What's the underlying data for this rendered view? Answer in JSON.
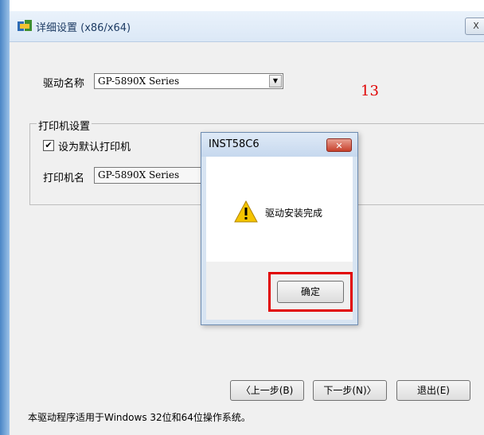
{
  "window": {
    "title": "详细设置 (x86/x64)",
    "close_symbol": "X"
  },
  "driver": {
    "label": "驱动名称",
    "value": "GP-5890X Series"
  },
  "annotation": "13",
  "printer_group": {
    "title": "打印机设置",
    "default_checkbox_label": "设为默认打印机",
    "default_checked": "✔",
    "printer_name_label": "打印机名",
    "printer_name_value": "GP-5890X Series"
  },
  "buttons": {
    "prev": "〈上一步(B)",
    "next": "下一步(N)〉",
    "exit": "退出(E)"
  },
  "footer_text": "本驱动程序适用于Windows 32位和64位操作系统。",
  "dialog": {
    "title": "INST58C6",
    "close_symbol": "✕",
    "message": "驱动安装完成",
    "ok_label": "确定",
    "highlight_color": "#e10000"
  }
}
